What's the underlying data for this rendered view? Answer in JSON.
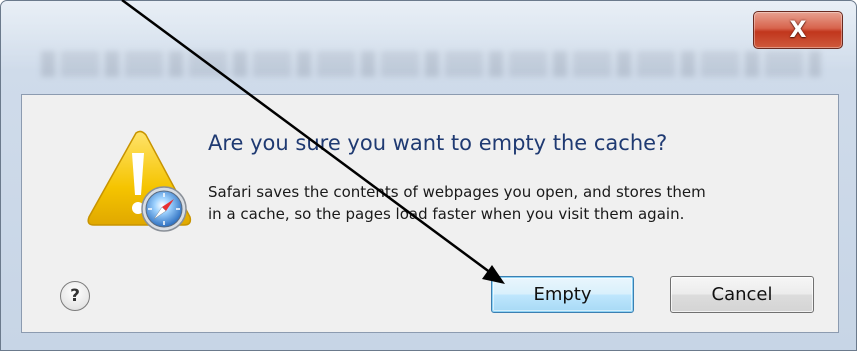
{
  "dialog": {
    "close_label": "X",
    "heading": "Are you sure you want to empty the cache?",
    "description_lines": [
      "Safari saves the contents of webpages you open, and stores them",
      "in a cache, so the pages load faster when you visit them again."
    ],
    "help_label": "?",
    "buttons": {
      "empty_label": "Empty",
      "cancel_label": "Cancel"
    },
    "icons": {
      "warning": "warning-triangle-icon",
      "safari": "safari-compass-icon",
      "help": "help-icon",
      "close": "close-icon"
    }
  },
  "colors": {
    "heading": "#1f3a72",
    "close_button": "#c1361d",
    "default_button_border": "#3c7fb1",
    "warning_yellow": "#f5c400",
    "annotation_arrow": "#000000"
  }
}
